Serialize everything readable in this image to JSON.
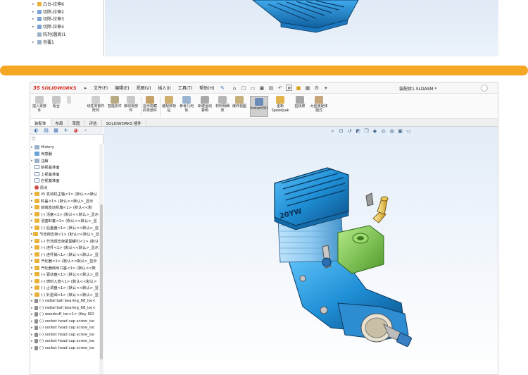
{
  "top_tree": {
    "items": [
      {
        "label": "凸台-拉伸6"
      },
      {
        "label": "切除-拉伸2"
      },
      {
        "label": "切除-拉伸3"
      },
      {
        "label": "切除-拉伸4"
      },
      {
        "label": "阵列(圆周)1"
      },
      {
        "label": "包覆1"
      }
    ]
  },
  "app": {
    "logo_ds": "3S",
    "logo_text": "SOLIDWORKS",
    "menu": [
      "文件(F)",
      "编辑(E)",
      "视图(V)",
      "插入(I)",
      "工具(T)",
      "帮助(H)"
    ],
    "document_title": "装配体1.SLDASM *"
  },
  "ribbon": {
    "buttons": [
      {
        "label": "插入零部件"
      },
      {
        "label": "配合"
      },
      {
        "label": "线性零部件阵列"
      },
      {
        "label": "智能扣件"
      },
      {
        "label": "移动零部件"
      },
      {
        "label": "显示隐藏的零部件"
      },
      {
        "label": "装配体特征"
      },
      {
        "label": "参考几何体"
      },
      {
        "label": "新建运动算例"
      },
      {
        "label": "材料明细表"
      },
      {
        "label": "爆炸视图"
      },
      {
        "label": "Instant3D"
      },
      {
        "label": "更新Speedpak"
      },
      {
        "label": "拍快照"
      },
      {
        "label": "大型装配体模式"
      }
    ]
  },
  "tabs": [
    "装配体",
    "布局",
    "草图",
    "评估",
    "SOLIDWORKS 插件"
  ],
  "tree": {
    "items": [
      {
        "label": "History",
        "icon": "history"
      },
      {
        "label": "传感器",
        "icon": "sensor"
      },
      {
        "label": "注解",
        "icon": "note"
      },
      {
        "label": "前视基准面",
        "icon": "plane"
      },
      {
        "label": "上视基准面",
        "icon": "plane"
      },
      {
        "label": "右视基准面",
        "icon": "plane"
      },
      {
        "label": "原点",
        "icon": "origin"
      },
      {
        "label": "(f) 发动机主轴<1> (默认<<默认",
        "icon": "part"
      },
      {
        "label": "缸盖<1> (默认<<默认>_显示",
        "icon": "part"
      },
      {
        "label": "前端发动机箱<1> (默认<<默",
        "icon": "part"
      },
      {
        "label": "(-) 活塞<1> (默认<<默认>_显示",
        "icon": "part"
      },
      {
        "label": "活塞缸套<1> (默认<<默认>_显",
        "icon": "part"
      },
      {
        "label": "(-) 后盖盘<1> (默认<<默认>_显",
        "icon": "part"
      },
      {
        "label": "节流阀支架<1> (默认<<默认>_显",
        "icon": "part"
      },
      {
        "label": "(-) 节流阀支架紧固螺钉<1> (默认",
        "icon": "part"
      },
      {
        "label": "(-) 连杆<1> (默认<<默认>_显示",
        "icon": "part"
      },
      {
        "label": "(-) 连杆销<1> (默认<<默认>_显",
        "icon": "part"
      },
      {
        "label": "汽化器<1> (默认<<默认>_显示",
        "icon": "part"
      },
      {
        "label": "汽化器阀出口塞<1> (默认<<默",
        "icon": "part"
      },
      {
        "label": "(-) 驱动盘<1> (默认<<默认>_显",
        "icon": "part"
      },
      {
        "label": "(-) 燃料入管<1> (默认<<默认>",
        "icon": "part"
      },
      {
        "label": "(-) 止调盘<1> (默认<<默认>_显",
        "icon": "part"
      },
      {
        "label": "(-) 针型阀<1> (默认<<默认>_显",
        "icon": "part"
      },
      {
        "label": "(-) radial ball bearing_68_iso<",
        "icon": "screw"
      },
      {
        "label": "(-) radial ball bearing_68_iso<",
        "icon": "screw"
      },
      {
        "label": "(-) woodruff_iso<1> (Key ISO",
        "icon": "screw"
      },
      {
        "label": "(-) socket head cap screw_iso",
        "icon": "screw"
      },
      {
        "label": "(-) socket head cap screw_iso",
        "icon": "screw"
      },
      {
        "label": "(-) socket head cap screw_iso",
        "icon": "screw"
      },
      {
        "label": "(-) socket head cap screw_iso",
        "icon": "screw"
      },
      {
        "label": "(-) socket head cap screw_iso",
        "icon": "screw"
      }
    ]
  },
  "model": {
    "head_label": "20YW"
  },
  "colors": {
    "divider": "#f5a623",
    "model_blue": "#1f8fd6",
    "model_green": "#7ec850",
    "brand_red": "#d52b1e"
  }
}
